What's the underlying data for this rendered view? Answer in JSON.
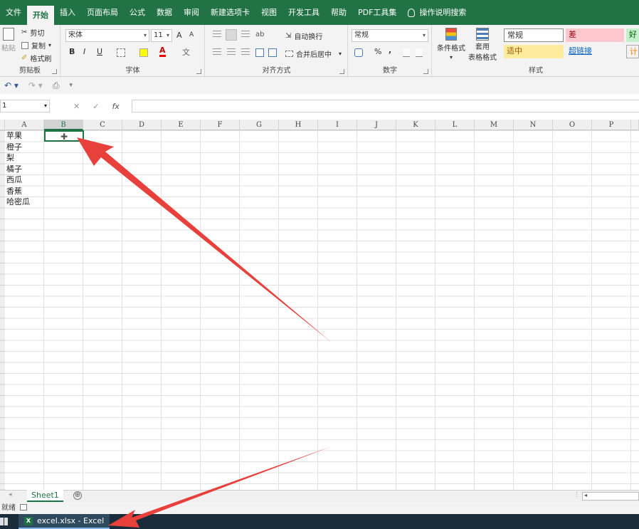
{
  "ribbon_tabs": [
    "文件",
    "开始",
    "插入",
    "页面布局",
    "公式",
    "数据",
    "审阅",
    "新建选项卡",
    "视图",
    "开发工具",
    "帮助",
    "PDF工具集"
  ],
  "active_tab_index": 1,
  "search_label": "操作说明搜索",
  "clipboard": {
    "paste": "粘贴",
    "cut": "剪切",
    "copy": "复制",
    "format_painter": "格式刷",
    "label": "剪贴板"
  },
  "font": {
    "name": "宋体",
    "size": "11",
    "grow": "A",
    "shrink": "A",
    "bold": "B",
    "italic": "I",
    "underline": "U",
    "font_color": "A",
    "label": "字体"
  },
  "alignment": {
    "wrap": "自动换行",
    "merge": "合并后居中",
    "orient": "ab",
    "label": "对齐方式"
  },
  "number": {
    "format": "常规",
    "percent": "%",
    "comma": ",",
    "label": "数字"
  },
  "styles_group": {
    "conditional": "条件格式",
    "table_line1": "套用",
    "table_line2": "表格格式",
    "cells": [
      {
        "text": "常规",
        "bg": "#ffffff",
        "color": "#333333"
      },
      {
        "text": "差",
        "bg": "#ffc7ce",
        "color": "#9c0006"
      },
      {
        "text": "好",
        "bg": "#c6efce",
        "color": "#006100"
      },
      {
        "text": "适中",
        "bg": "#ffeb9c",
        "color": "#9c5700"
      },
      {
        "text": "超链接",
        "bg": "#f3f3f3",
        "color": "#0563c1"
      },
      {
        "text": "计",
        "bg": "#f2f2f2",
        "color": "#fa7d00"
      }
    ],
    "label": "样式"
  },
  "formula_bar": {
    "name_box": "1",
    "fx": "fx",
    "cancel": "✕",
    "enter": "✓",
    "content": ""
  },
  "columns": [
    "A",
    "B",
    "C",
    "D",
    "E",
    "F",
    "G",
    "H",
    "I",
    "J",
    "K",
    "L",
    "M",
    "N",
    "O",
    "P"
  ],
  "selected_column": "B",
  "cells_a": [
    "苹果",
    "橙子",
    "梨",
    "橘子",
    "西瓜",
    "香蕉",
    "哈密瓜"
  ],
  "sheet_tab": "Sheet1",
  "add_sheet": "⊕",
  "status_text": "就绪",
  "taskbar_item": "excel.xlsx - Excel",
  "accent_color": "#217346",
  "annotation_color": "#e8403a"
}
